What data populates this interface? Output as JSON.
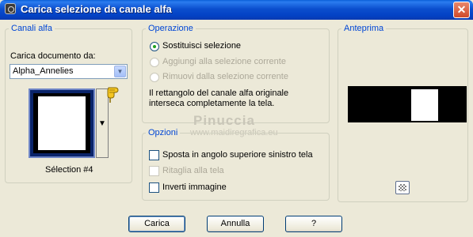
{
  "window": {
    "title": "Carica selezione da canale alfa",
    "close_glyph": "✕"
  },
  "alpha_channels": {
    "legend": "Canali alfa",
    "load_from_label": "Carica documento da:",
    "document_value": "Alpha_Annelies",
    "selection_caption": "Sélection #4"
  },
  "operation": {
    "legend": "Operazione",
    "options": [
      {
        "label": "Sostituisci selezione",
        "selected": true,
        "enabled": true
      },
      {
        "label": "Aggiungi alla selezione corrente",
        "selected": false,
        "enabled": false
      },
      {
        "label": "Rimuovi dalla selezione corrente",
        "selected": false,
        "enabled": false
      }
    ],
    "info_line1": "Il rettangolo del canale alfa originale",
    "info_line2": "interseca completamente la tela."
  },
  "options_group": {
    "legend": "Opzioni",
    "items": [
      {
        "label": "Sposta in angolo superiore sinistro tela",
        "checked": false,
        "enabled": true
      },
      {
        "label": "Ritaglia alla tela",
        "checked": false,
        "enabled": false
      },
      {
        "label": "Inverti immagine",
        "checked": false,
        "enabled": true
      }
    ]
  },
  "preview": {
    "legend": "Anteprima"
  },
  "watermark": {
    "line1": "Pinuccia",
    "line2": "www.maidiregrafica.eu"
  },
  "buttons": {
    "load": "Carica",
    "cancel": "Annulla",
    "help": "?"
  },
  "icons": {
    "app": "app-icon",
    "close": "close-icon",
    "dropdown": "chevron-down-icon",
    "hand": "pointing-hand-icon",
    "zoom": "checkerboard-zoom-icon"
  },
  "colors": {
    "title_bar": "#0b4fce",
    "group_legend": "#0046d5",
    "dialog_bg": "#ece9d8"
  }
}
